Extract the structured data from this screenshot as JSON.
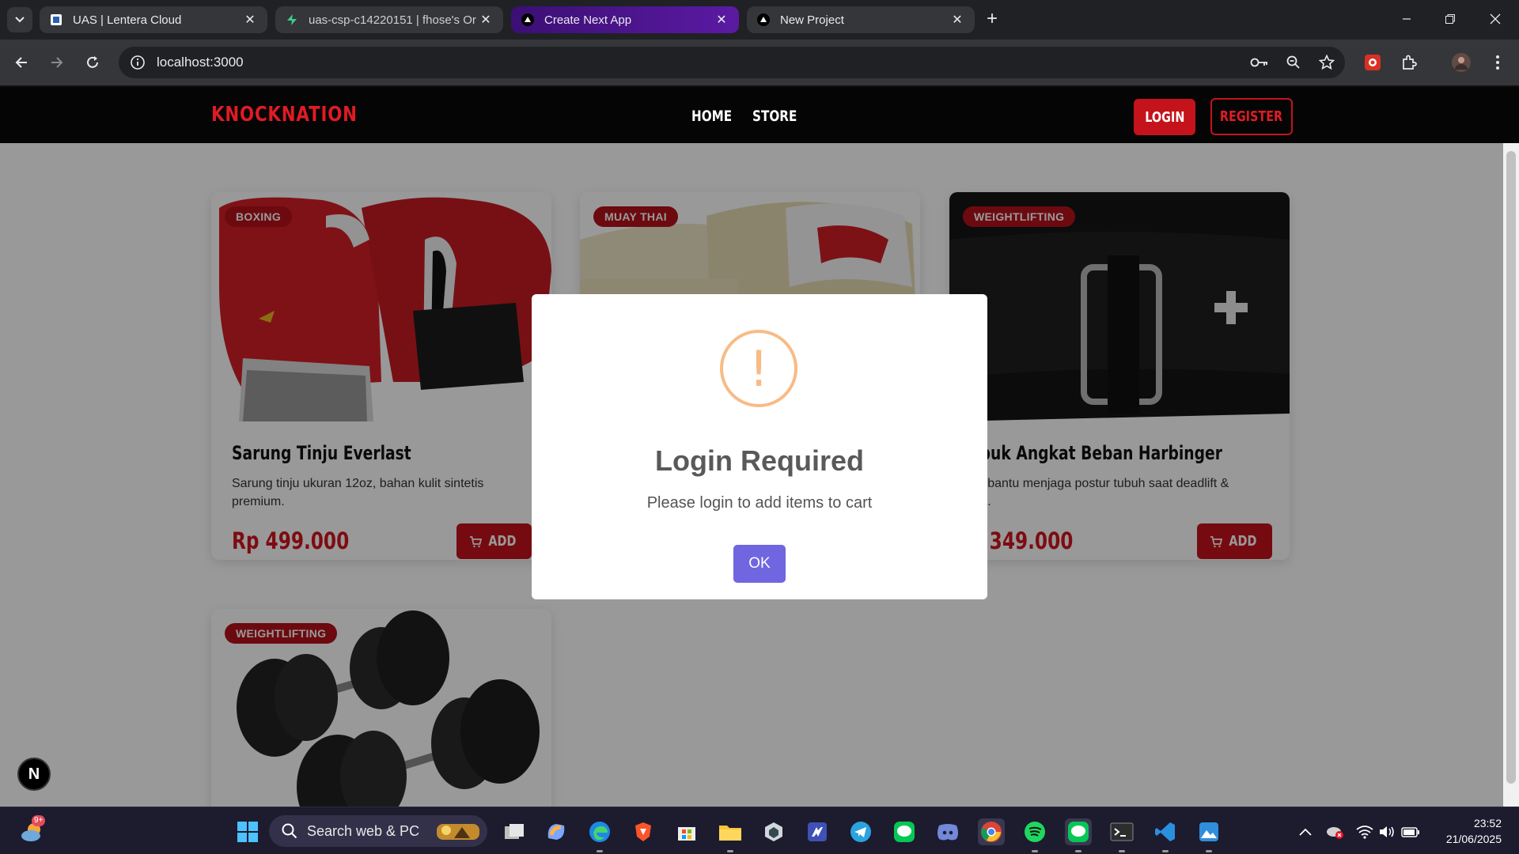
{
  "browser": {
    "tabs": [
      {
        "title": "UAS | Lentera Cloud",
        "icon": "lentera-favicon",
        "active": false
      },
      {
        "title": "uas-csp-c14220151 | fhose's Or",
        "icon": "supabase-favicon",
        "active": false
      },
      {
        "title": "Create Next App",
        "icon": "vercel-favicon",
        "active": true
      },
      {
        "title": "New Project",
        "icon": "vercel-favicon",
        "active": false
      }
    ],
    "url": "localhost:3000"
  },
  "site": {
    "brand": "KNOCKNATION",
    "nav": {
      "home": "HOME",
      "store": "STORE"
    },
    "login": "LOGIN",
    "register": "REGISTER"
  },
  "products": [
    {
      "badge": "BOXING",
      "name": "Sarung Tinju Everlast",
      "desc": "Sarung tinju ukuran 12oz, bahan kulit sintetis premium.",
      "price": "Rp 499.000",
      "add": "ADD"
    },
    {
      "badge": "MUAY THAI",
      "name": "",
      "desc": "",
      "price": "",
      "add": ""
    },
    {
      "badge": "WEIGHTLIFTING",
      "name": "abuk Angkat Beban Harbinger",
      "desc": "embantu menjaga postur tubuh saat deadlift & uat.",
      "price": "p 349.000",
      "add": "ADD"
    },
    {
      "badge": "WEIGHTLIFTING",
      "name": "",
      "desc": "",
      "price": "",
      "add": ""
    }
  ],
  "modal": {
    "title": "Login Required",
    "text": "Please login to add items to cart",
    "ok": "OK",
    "icon": "!"
  },
  "dev": {
    "next_indicator": "N"
  },
  "taskbar": {
    "search_placeholder": "Search web & PC",
    "weather_badge": "9+",
    "time": "23:52",
    "date": "21/06/2025"
  },
  "colors": {
    "brand_red": "#c4131b",
    "modal_button": "#7066e0",
    "warning": "#f8bb86",
    "active_tab": "#4a148c"
  }
}
